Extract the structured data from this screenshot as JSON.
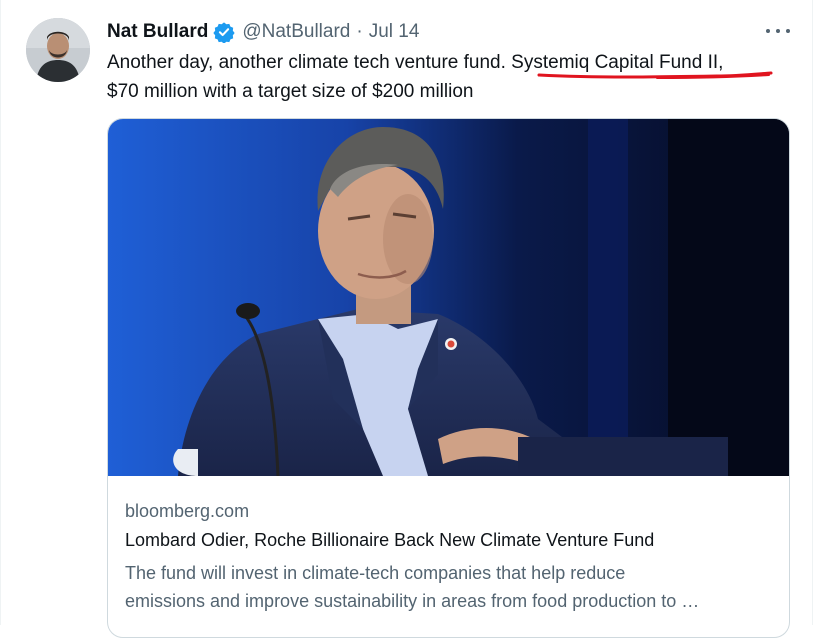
{
  "tweet": {
    "author": {
      "name": "Nat Bullard",
      "handle": "@NatBullard",
      "verified": true,
      "avatar_icon": "profile-photo"
    },
    "separator": "·",
    "date": "Jul 14",
    "more_icon": "more-horizontal-icon",
    "text": {
      "part1": "Another day, another climate tech venture fund.",
      "highlight": "Systemiq Capital Fund II,",
      "part2": "$70 million with a target size of $200 million"
    },
    "highlight_color": "#e0141f"
  },
  "card": {
    "image_icon": "news-photo",
    "domain": "bloomberg.com",
    "title": "Lombard Odier, Roche Billionaire Back New Climate Venture Fund",
    "description_line1": "The fund will invest in climate-tech companies that help reduce",
    "description_line2": "emissions and improve sustainability in areas from food production to …"
  },
  "colors": {
    "text_primary": "#0f1419",
    "text_secondary": "#536471",
    "verified_blue": "#1d9bf0",
    "border": "#cfd9de"
  }
}
